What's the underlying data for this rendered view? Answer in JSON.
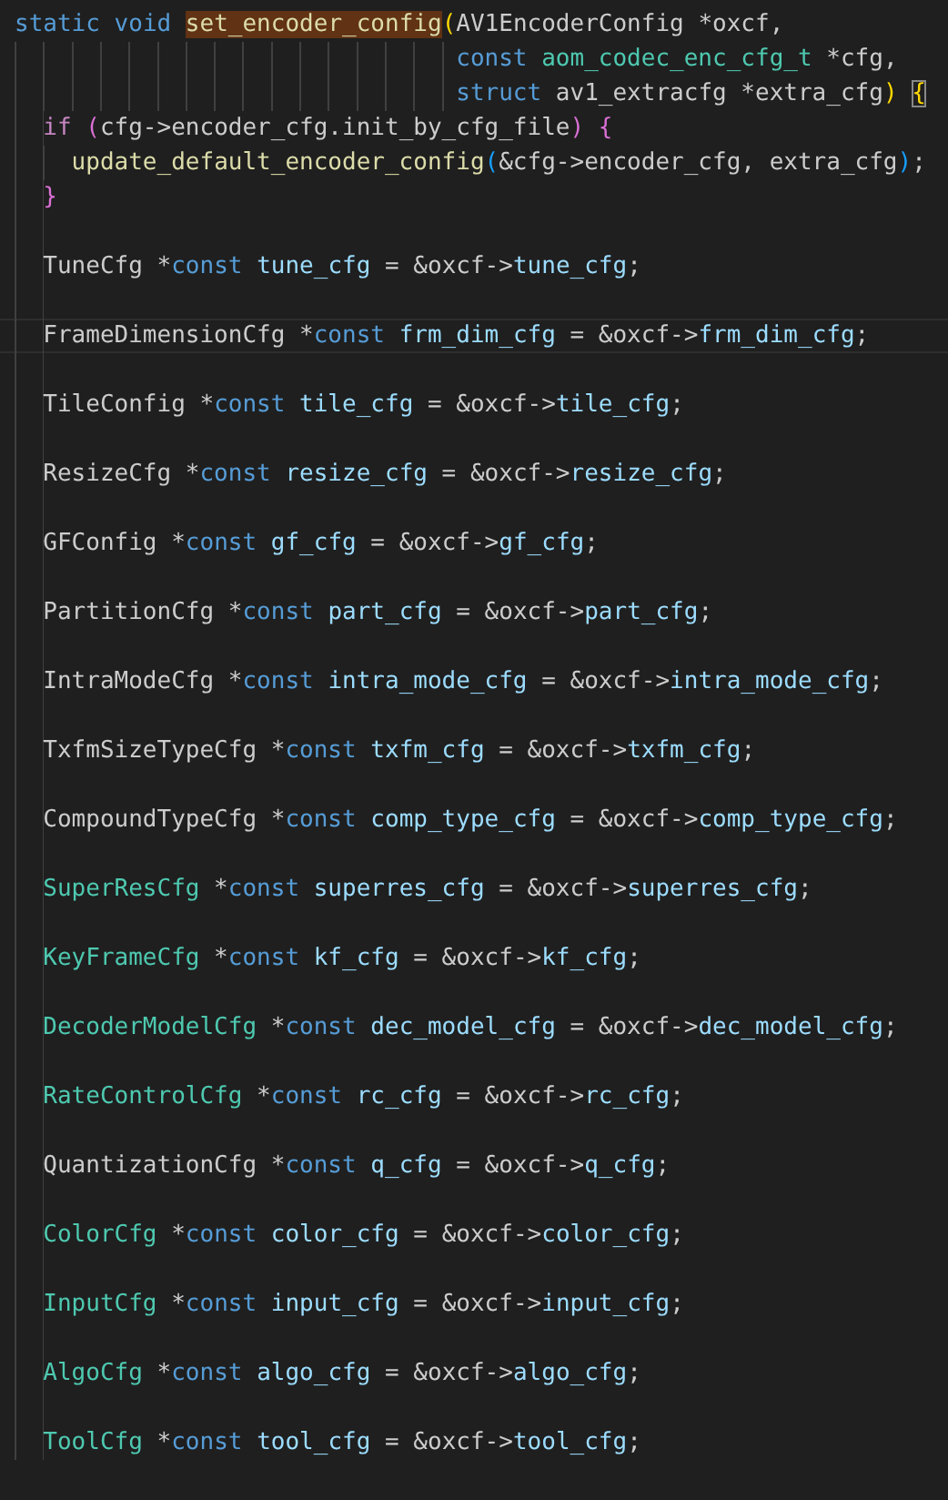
{
  "editor": {
    "lines": [
      {
        "blank": false,
        "current": false,
        "tokens": [
          {
            "text": "static void ",
            "kind": "keyword"
          },
          {
            "text": "set_encoder_config",
            "kind": "func-match"
          },
          {
            "text": "(",
            "kind": "bracket1"
          },
          {
            "text": "AV1EncoderConfig *oxcf,",
            "kind": "plain"
          }
        ]
      },
      {
        "blank": false,
        "current": false,
        "tokens": [
          {
            "text": "                               const ",
            "kind": "keyword"
          },
          {
            "text": "aom_codec_enc_cfg_t",
            "kind": "type"
          },
          {
            "text": " *cfg,",
            "kind": "plain"
          }
        ]
      },
      {
        "blank": false,
        "current": false,
        "tokens": [
          {
            "text": "                               struct ",
            "kind": "keyword"
          },
          {
            "text": "av1_extracfg *extra_cfg",
            "kind": "plain"
          },
          {
            "text": ") ",
            "kind": "bracket1"
          },
          {
            "text": "{",
            "kind": "bracket1-match"
          }
        ]
      },
      {
        "blank": false,
        "current": false,
        "tokens": [
          {
            "text": "  if ",
            "kind": "control"
          },
          {
            "text": "(",
            "kind": "bracket2"
          },
          {
            "text": "cfg->encoder_cfg.init_by_cfg_file",
            "kind": "plain"
          },
          {
            "text": ") {",
            "kind": "bracket2"
          }
        ]
      },
      {
        "blank": false,
        "current": false,
        "tokens": [
          {
            "text": "    update_default_encoder_config",
            "kind": "func"
          },
          {
            "text": "(",
            "kind": "bracket3"
          },
          {
            "text": "&cfg->encoder_cfg, extra_cfg",
            "kind": "plain"
          },
          {
            "text": ")",
            "kind": "bracket3"
          },
          {
            "text": ";",
            "kind": "plain"
          }
        ]
      },
      {
        "blank": false,
        "current": false,
        "tokens": [
          {
            "text": "  }",
            "kind": "bracket2"
          }
        ]
      },
      {
        "blank": true,
        "current": false
      },
      {
        "blank": false,
        "current": false,
        "tokens": [
          {
            "text": "  TuneCfg *",
            "kind": "plain"
          },
          {
            "text": "const ",
            "kind": "keyword"
          },
          {
            "text": "tune_cfg",
            "kind": "name"
          },
          {
            "text": " = &oxcf->",
            "kind": "plain"
          },
          {
            "text": "tune_cfg",
            "kind": "name"
          },
          {
            "text": ";",
            "kind": "plain"
          }
        ]
      },
      {
        "blank": true,
        "current": false
      },
      {
        "blank": false,
        "current": true,
        "tokens": [
          {
            "text": "  FrameDimensionCfg *",
            "kind": "plain"
          },
          {
            "text": "const ",
            "kind": "keyword"
          },
          {
            "text": "frm_dim_cfg",
            "kind": "name"
          },
          {
            "text": " = &oxcf->",
            "kind": "plain"
          },
          {
            "text": "frm_dim_cfg",
            "kind": "name"
          },
          {
            "text": ";",
            "kind": "plain"
          }
        ]
      },
      {
        "blank": true,
        "current": false
      },
      {
        "blank": false,
        "current": false,
        "tokens": [
          {
            "text": "  TileConfig *",
            "kind": "plain"
          },
          {
            "text": "const ",
            "kind": "keyword"
          },
          {
            "text": "tile_cfg",
            "kind": "name"
          },
          {
            "text": " = &oxcf->",
            "kind": "plain"
          },
          {
            "text": "tile_cfg",
            "kind": "name"
          },
          {
            "text": ";",
            "kind": "plain"
          }
        ]
      },
      {
        "blank": true,
        "current": false
      },
      {
        "blank": false,
        "current": false,
        "tokens": [
          {
            "text": "  ResizeCfg *",
            "kind": "plain"
          },
          {
            "text": "const ",
            "kind": "keyword"
          },
          {
            "text": "resize_cfg",
            "kind": "name"
          },
          {
            "text": " = &oxcf->",
            "kind": "plain"
          },
          {
            "text": "resize_cfg",
            "kind": "name"
          },
          {
            "text": ";",
            "kind": "plain"
          }
        ]
      },
      {
        "blank": true,
        "current": false
      },
      {
        "blank": false,
        "current": false,
        "tokens": [
          {
            "text": "  GFConfig *",
            "kind": "plain"
          },
          {
            "text": "const ",
            "kind": "keyword"
          },
          {
            "text": "gf_cfg",
            "kind": "name"
          },
          {
            "text": " = &oxcf->",
            "kind": "plain"
          },
          {
            "text": "gf_cfg",
            "kind": "name"
          },
          {
            "text": ";",
            "kind": "plain"
          }
        ]
      },
      {
        "blank": true,
        "current": false
      },
      {
        "blank": false,
        "current": false,
        "tokens": [
          {
            "text": "  PartitionCfg *",
            "kind": "plain"
          },
          {
            "text": "const ",
            "kind": "keyword"
          },
          {
            "text": "part_cfg",
            "kind": "name"
          },
          {
            "text": " = &oxcf->",
            "kind": "plain"
          },
          {
            "text": "part_cfg",
            "kind": "name"
          },
          {
            "text": ";",
            "kind": "plain"
          }
        ]
      },
      {
        "blank": true,
        "current": false
      },
      {
        "blank": false,
        "current": false,
        "tokens": [
          {
            "text": "  IntraModeCfg *",
            "kind": "plain"
          },
          {
            "text": "const ",
            "kind": "keyword"
          },
          {
            "text": "intra_mode_cfg",
            "kind": "name"
          },
          {
            "text": " = &oxcf->",
            "kind": "plain"
          },
          {
            "text": "intra_mode_cfg",
            "kind": "name"
          },
          {
            "text": ";",
            "kind": "plain"
          }
        ]
      },
      {
        "blank": true,
        "current": false
      },
      {
        "blank": false,
        "current": false,
        "tokens": [
          {
            "text": "  TxfmSizeTypeCfg *",
            "kind": "plain"
          },
          {
            "text": "const ",
            "kind": "keyword"
          },
          {
            "text": "txfm_cfg",
            "kind": "name"
          },
          {
            "text": " = &oxcf->",
            "kind": "plain"
          },
          {
            "text": "txfm_cfg",
            "kind": "name"
          },
          {
            "text": ";",
            "kind": "plain"
          }
        ]
      },
      {
        "blank": true,
        "current": false
      },
      {
        "blank": false,
        "current": false,
        "tokens": [
          {
            "text": "  CompoundTypeCfg *",
            "kind": "plain"
          },
          {
            "text": "const ",
            "kind": "keyword"
          },
          {
            "text": "comp_type_cfg",
            "kind": "name"
          },
          {
            "text": " = &oxcf->",
            "kind": "plain"
          },
          {
            "text": "comp_type_cfg",
            "kind": "name"
          },
          {
            "text": ";",
            "kind": "plain"
          }
        ]
      },
      {
        "blank": true,
        "current": false
      },
      {
        "blank": false,
        "current": false,
        "tokens": [
          {
            "text": "  SuperResCfg",
            "kind": "type"
          },
          {
            "text": " *",
            "kind": "plain"
          },
          {
            "text": "const ",
            "kind": "keyword"
          },
          {
            "text": "superres_cfg",
            "kind": "name"
          },
          {
            "text": " = &oxcf->",
            "kind": "plain"
          },
          {
            "text": "superres_cfg",
            "kind": "name"
          },
          {
            "text": ";",
            "kind": "plain"
          }
        ]
      },
      {
        "blank": true,
        "current": false
      },
      {
        "blank": false,
        "current": false,
        "tokens": [
          {
            "text": "  KeyFrameCfg",
            "kind": "type"
          },
          {
            "text": " *",
            "kind": "plain"
          },
          {
            "text": "const ",
            "kind": "keyword"
          },
          {
            "text": "kf_cfg",
            "kind": "name"
          },
          {
            "text": " = &oxcf->",
            "kind": "plain"
          },
          {
            "text": "kf_cfg",
            "kind": "name"
          },
          {
            "text": ";",
            "kind": "plain"
          }
        ]
      },
      {
        "blank": true,
        "current": false
      },
      {
        "blank": false,
        "current": false,
        "tokens": [
          {
            "text": "  DecoderModelCfg",
            "kind": "type"
          },
          {
            "text": " *",
            "kind": "plain"
          },
          {
            "text": "const ",
            "kind": "keyword"
          },
          {
            "text": "dec_model_cfg",
            "kind": "name"
          },
          {
            "text": " = &oxcf->",
            "kind": "plain"
          },
          {
            "text": "dec_model_cfg",
            "kind": "name"
          },
          {
            "text": ";",
            "kind": "plain"
          }
        ]
      },
      {
        "blank": true,
        "current": false
      },
      {
        "blank": false,
        "current": false,
        "tokens": [
          {
            "text": "  RateControlCfg",
            "kind": "type"
          },
          {
            "text": " *",
            "kind": "plain"
          },
          {
            "text": "const ",
            "kind": "keyword"
          },
          {
            "text": "rc_cfg",
            "kind": "name"
          },
          {
            "text": " = &oxcf->",
            "kind": "plain"
          },
          {
            "text": "rc_cfg",
            "kind": "name"
          },
          {
            "text": ";",
            "kind": "plain"
          }
        ]
      },
      {
        "blank": true,
        "current": false
      },
      {
        "blank": false,
        "current": false,
        "tokens": [
          {
            "text": "  QuantizationCfg *",
            "kind": "plain"
          },
          {
            "text": "const ",
            "kind": "keyword"
          },
          {
            "text": "q_cfg",
            "kind": "name"
          },
          {
            "text": " = &oxcf->",
            "kind": "plain"
          },
          {
            "text": "q_cfg",
            "kind": "name"
          },
          {
            "text": ";",
            "kind": "plain"
          }
        ]
      },
      {
        "blank": true,
        "current": false
      },
      {
        "blank": false,
        "current": false,
        "tokens": [
          {
            "text": "  ColorCfg",
            "kind": "type"
          },
          {
            "text": " *",
            "kind": "plain"
          },
          {
            "text": "const ",
            "kind": "keyword"
          },
          {
            "text": "color_cfg",
            "kind": "name"
          },
          {
            "text": " = &oxcf->",
            "kind": "plain"
          },
          {
            "text": "color_cfg",
            "kind": "name"
          },
          {
            "text": ";",
            "kind": "plain"
          }
        ]
      },
      {
        "blank": true,
        "current": false
      },
      {
        "blank": false,
        "current": false,
        "tokens": [
          {
            "text": "  InputCfg",
            "kind": "type"
          },
          {
            "text": " *",
            "kind": "plain"
          },
          {
            "text": "const ",
            "kind": "keyword"
          },
          {
            "text": "input_cfg",
            "kind": "name"
          },
          {
            "text": " = &oxcf->",
            "kind": "plain"
          },
          {
            "text": "input_cfg",
            "kind": "name"
          },
          {
            "text": ";",
            "kind": "plain"
          }
        ]
      },
      {
        "blank": true,
        "current": false
      },
      {
        "blank": false,
        "current": false,
        "tokens": [
          {
            "text": "  AlgoCfg",
            "kind": "type"
          },
          {
            "text": " *",
            "kind": "plain"
          },
          {
            "text": "const ",
            "kind": "keyword"
          },
          {
            "text": "algo_cfg",
            "kind": "name"
          },
          {
            "text": " = &oxcf->",
            "kind": "plain"
          },
          {
            "text": "algo_cfg",
            "kind": "name"
          },
          {
            "text": ";",
            "kind": "plain"
          }
        ]
      },
      {
        "blank": true,
        "current": false
      },
      {
        "blank": false,
        "current": false,
        "tokens": [
          {
            "text": "  ToolCfg",
            "kind": "type"
          },
          {
            "text": " *",
            "kind": "plain"
          },
          {
            "text": "const ",
            "kind": "keyword"
          },
          {
            "text": "tool_cfg",
            "kind": "name"
          },
          {
            "text": " = &oxcf->",
            "kind": "plain"
          },
          {
            "text": "tool_cfg",
            "kind": "name"
          },
          {
            "text": ";",
            "kind": "plain"
          }
        ]
      }
    ]
  }
}
